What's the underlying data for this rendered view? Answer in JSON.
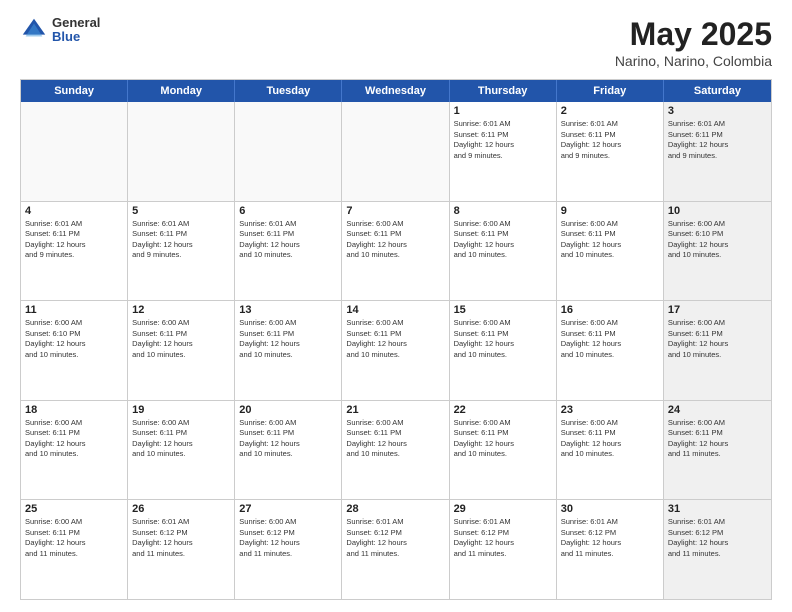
{
  "logo": {
    "general": "General",
    "blue": "Blue"
  },
  "title": "May 2025",
  "subtitle": "Narino, Narino, Colombia",
  "header_days": [
    "Sunday",
    "Monday",
    "Tuesday",
    "Wednesday",
    "Thursday",
    "Friday",
    "Saturday"
  ],
  "rows": [
    [
      {
        "day": "",
        "empty": true
      },
      {
        "day": "",
        "empty": true
      },
      {
        "day": "",
        "empty": true
      },
      {
        "day": "",
        "empty": true
      },
      {
        "day": "1",
        "info": "Sunrise: 6:01 AM\nSunset: 6:11 PM\nDaylight: 12 hours\nand 9 minutes."
      },
      {
        "day": "2",
        "info": "Sunrise: 6:01 AM\nSunset: 6:11 PM\nDaylight: 12 hours\nand 9 minutes."
      },
      {
        "day": "3",
        "info": "Sunrise: 6:01 AM\nSunset: 6:11 PM\nDaylight: 12 hours\nand 9 minutes.",
        "shaded": true
      }
    ],
    [
      {
        "day": "4",
        "info": "Sunrise: 6:01 AM\nSunset: 6:11 PM\nDaylight: 12 hours\nand 9 minutes."
      },
      {
        "day": "5",
        "info": "Sunrise: 6:01 AM\nSunset: 6:11 PM\nDaylight: 12 hours\nand 9 minutes."
      },
      {
        "day": "6",
        "info": "Sunrise: 6:01 AM\nSunset: 6:11 PM\nDaylight: 12 hours\nand 10 minutes."
      },
      {
        "day": "7",
        "info": "Sunrise: 6:00 AM\nSunset: 6:11 PM\nDaylight: 12 hours\nand 10 minutes."
      },
      {
        "day": "8",
        "info": "Sunrise: 6:00 AM\nSunset: 6:11 PM\nDaylight: 12 hours\nand 10 minutes."
      },
      {
        "day": "9",
        "info": "Sunrise: 6:00 AM\nSunset: 6:11 PM\nDaylight: 12 hours\nand 10 minutes."
      },
      {
        "day": "10",
        "info": "Sunrise: 6:00 AM\nSunset: 6:10 PM\nDaylight: 12 hours\nand 10 minutes.",
        "shaded": true
      }
    ],
    [
      {
        "day": "11",
        "info": "Sunrise: 6:00 AM\nSunset: 6:10 PM\nDaylight: 12 hours\nand 10 minutes."
      },
      {
        "day": "12",
        "info": "Sunrise: 6:00 AM\nSunset: 6:11 PM\nDaylight: 12 hours\nand 10 minutes."
      },
      {
        "day": "13",
        "info": "Sunrise: 6:00 AM\nSunset: 6:11 PM\nDaylight: 12 hours\nand 10 minutes."
      },
      {
        "day": "14",
        "info": "Sunrise: 6:00 AM\nSunset: 6:11 PM\nDaylight: 12 hours\nand 10 minutes."
      },
      {
        "day": "15",
        "info": "Sunrise: 6:00 AM\nSunset: 6:11 PM\nDaylight: 12 hours\nand 10 minutes."
      },
      {
        "day": "16",
        "info": "Sunrise: 6:00 AM\nSunset: 6:11 PM\nDaylight: 12 hours\nand 10 minutes."
      },
      {
        "day": "17",
        "info": "Sunrise: 6:00 AM\nSunset: 6:11 PM\nDaylight: 12 hours\nand 10 minutes.",
        "shaded": true
      }
    ],
    [
      {
        "day": "18",
        "info": "Sunrise: 6:00 AM\nSunset: 6:11 PM\nDaylight: 12 hours\nand 10 minutes."
      },
      {
        "day": "19",
        "info": "Sunrise: 6:00 AM\nSunset: 6:11 PM\nDaylight: 12 hours\nand 10 minutes."
      },
      {
        "day": "20",
        "info": "Sunrise: 6:00 AM\nSunset: 6:11 PM\nDaylight: 12 hours\nand 10 minutes."
      },
      {
        "day": "21",
        "info": "Sunrise: 6:00 AM\nSunset: 6:11 PM\nDaylight: 12 hours\nand 10 minutes."
      },
      {
        "day": "22",
        "info": "Sunrise: 6:00 AM\nSunset: 6:11 PM\nDaylight: 12 hours\nand 10 minutes."
      },
      {
        "day": "23",
        "info": "Sunrise: 6:00 AM\nSunset: 6:11 PM\nDaylight: 12 hours\nand 10 minutes."
      },
      {
        "day": "24",
        "info": "Sunrise: 6:00 AM\nSunset: 6:11 PM\nDaylight: 12 hours\nand 11 minutes.",
        "shaded": true
      }
    ],
    [
      {
        "day": "25",
        "info": "Sunrise: 6:00 AM\nSunset: 6:11 PM\nDaylight: 12 hours\nand 11 minutes."
      },
      {
        "day": "26",
        "info": "Sunrise: 6:01 AM\nSunset: 6:12 PM\nDaylight: 12 hours\nand 11 minutes."
      },
      {
        "day": "27",
        "info": "Sunrise: 6:00 AM\nSunset: 6:12 PM\nDaylight: 12 hours\nand 11 minutes."
      },
      {
        "day": "28",
        "info": "Sunrise: 6:01 AM\nSunset: 6:12 PM\nDaylight: 12 hours\nand 11 minutes."
      },
      {
        "day": "29",
        "info": "Sunrise: 6:01 AM\nSunset: 6:12 PM\nDaylight: 12 hours\nand 11 minutes."
      },
      {
        "day": "30",
        "info": "Sunrise: 6:01 AM\nSunset: 6:12 PM\nDaylight: 12 hours\nand 11 minutes."
      },
      {
        "day": "31",
        "info": "Sunrise: 6:01 AM\nSunset: 6:12 PM\nDaylight: 12 hours\nand 11 minutes.",
        "shaded": true
      }
    ]
  ]
}
